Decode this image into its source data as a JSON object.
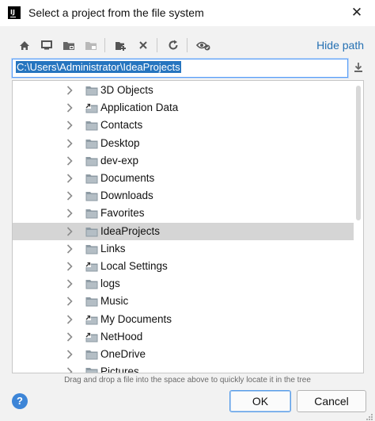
{
  "window": {
    "title": "Select a project from the file system",
    "app_icon": "intellij-icon",
    "close_glyph": "✕"
  },
  "toolbar": {
    "buttons": [
      "home-icon",
      "desktop-icon",
      "project-folder-icon",
      "module-folder-icon",
      "new-folder-icon",
      "delete-icon",
      "refresh-icon",
      "show-hidden-icon"
    ],
    "hide_path_label": "Hide path"
  },
  "path": {
    "value": "C:\\Users\\Administrator\\IdeaProjects"
  },
  "tree": {
    "items": [
      {
        "label": "3D Objects",
        "icon": "folder-icon",
        "selected": false
      },
      {
        "label": "Application Data",
        "icon": "folder-link-icon",
        "selected": false
      },
      {
        "label": "Contacts",
        "icon": "folder-icon",
        "selected": false
      },
      {
        "label": "Desktop",
        "icon": "folder-icon",
        "selected": false
      },
      {
        "label": "dev-exp",
        "icon": "folder-icon",
        "selected": false
      },
      {
        "label": "Documents",
        "icon": "folder-icon",
        "selected": false
      },
      {
        "label": "Downloads",
        "icon": "folder-icon",
        "selected": false
      },
      {
        "label": "Favorites",
        "icon": "folder-icon",
        "selected": false
      },
      {
        "label": "IdeaProjects",
        "icon": "folder-icon",
        "selected": true
      },
      {
        "label": "Links",
        "icon": "folder-icon",
        "selected": false
      },
      {
        "label": "Local Settings",
        "icon": "folder-link-icon",
        "selected": false
      },
      {
        "label": "logs",
        "icon": "folder-icon",
        "selected": false
      },
      {
        "label": "Music",
        "icon": "folder-icon",
        "selected": false
      },
      {
        "label": "My Documents",
        "icon": "folder-link-icon",
        "selected": false
      },
      {
        "label": "NetHood",
        "icon": "folder-link-icon",
        "selected": false
      },
      {
        "label": "OneDrive",
        "icon": "folder-icon",
        "selected": false
      },
      {
        "label": "Pictures",
        "icon": "folder-icon",
        "selected": false
      }
    ]
  },
  "hint": "Drag and drop a file into the space above to quickly locate it in the tree",
  "footer": {
    "help_label": "?",
    "ok_label": "OK",
    "cancel_label": "Cancel"
  },
  "colors": {
    "accent": "#2675bf",
    "link": "#2470b3",
    "selection_row": "#d5d5d5",
    "folder": "#8d9aa3"
  }
}
